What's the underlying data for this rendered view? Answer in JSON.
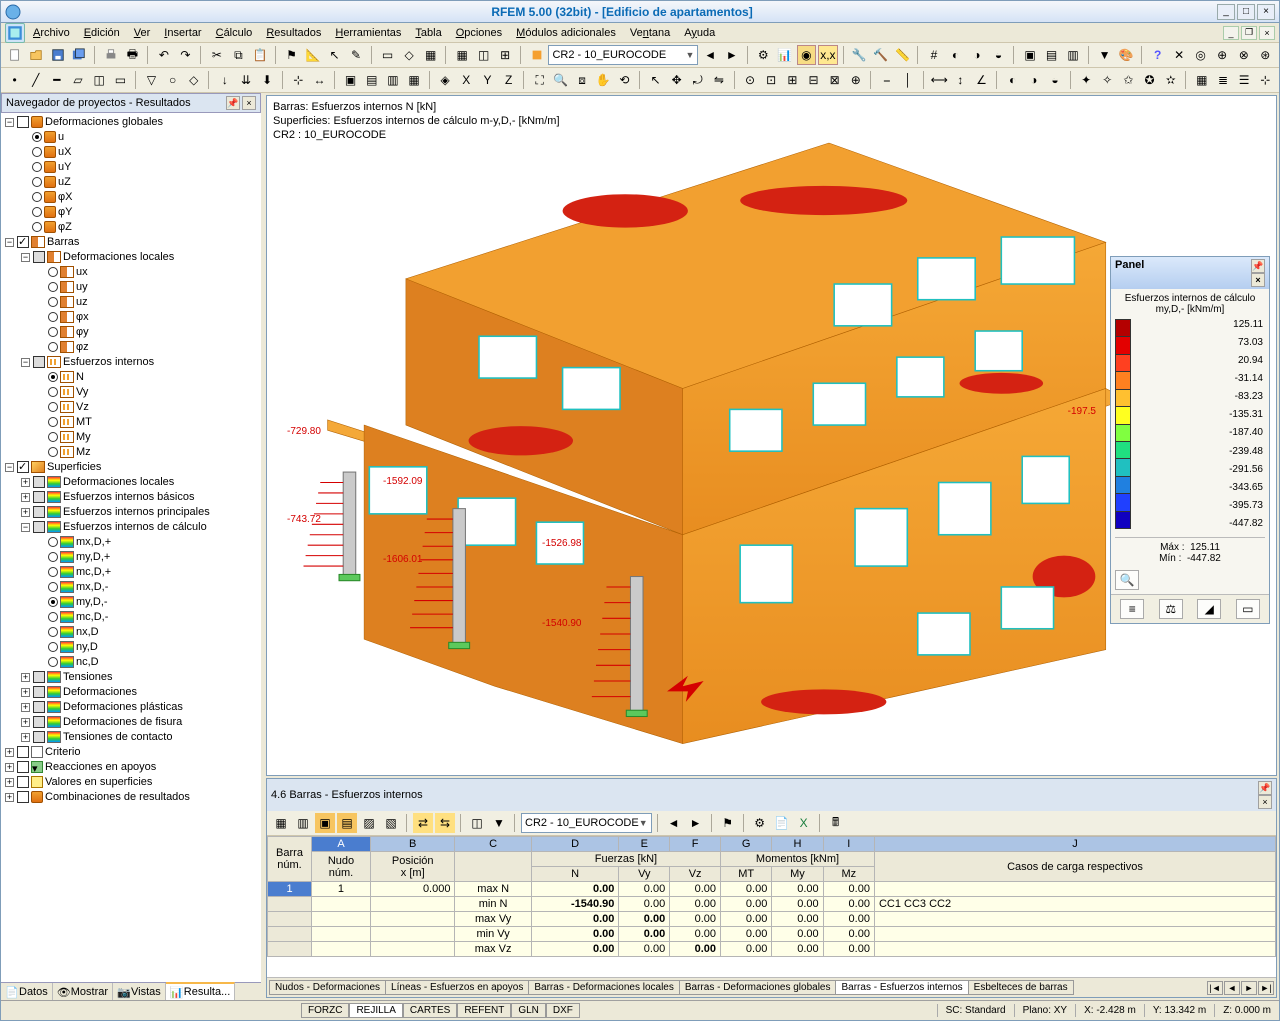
{
  "title": "RFEM 5.00 (32bit) - [Edificio de apartamentos]",
  "menu": [
    "Archivo",
    "Edición",
    "Ver",
    "Insertar",
    "Cálculo",
    "Resultados",
    "Herramientas",
    "Tabla",
    "Opciones",
    "Módulos adicionales",
    "Ventana",
    "Ayuda"
  ],
  "toolbar_combo": "CR2 - 10_EUROCODE",
  "navigator": {
    "title": "Navegador de proyectos - Resultados",
    "items": {
      "def_glob": "Deformaciones globales",
      "u": "u",
      "ux": "uX",
      "uy": "uY",
      "uz": "uZ",
      "phix": "φX",
      "phiy": "φY",
      "phiz": "φZ",
      "barras": "Barras",
      "def_loc": "Deformaciones locales",
      "ux2": "ux",
      "uy2": "uy",
      "uz2": "uz",
      "phix2": "φx",
      "phiy2": "φy",
      "phiz2": "φz",
      "esf_int": "Esfuerzos internos",
      "N": "N",
      "Vy": "Vy",
      "Vz": "Vz",
      "MT": "MT",
      "My": "My",
      "Mz": "Mz",
      "superficies": "Superficies",
      "sup_defloc": "Deformaciones locales",
      "sup_esfb": "Esfuerzos internos básicos",
      "sup_esfp": "Esfuerzos internos principales",
      "sup_esfc": "Esfuerzos internos de cálculo",
      "mxdp": "mx,D,+",
      "mydp": "my,D,+",
      "mcdp": "mc,D,+",
      "mxdm": "mx,D,-",
      "mydm": "my,D,-",
      "mcdm": "mc,D,-",
      "nxd": "nx,D",
      "nyd": "ny,D",
      "ncd": "nc,D",
      "tensiones": "Tensiones",
      "deformaciones": "Deformaciones",
      "def_plast": "Deformaciones plásticas",
      "def_fis": "Deformaciones de fisura",
      "ten_cont": "Tensiones de contacto",
      "criterio": "Criterio",
      "reac": "Reacciones en apoyos",
      "val_sup": "Valores en superficies",
      "comb": "Combinaciones de resultados"
    },
    "tabs": [
      "Datos",
      "Mostrar",
      "Vistas",
      "Resulta..."
    ]
  },
  "canvas": {
    "lines": [
      "Barras: Esfuerzos internos N [kN]",
      "Superficies: Esfuerzos internos de cálculo m-y,D,- [kNm/m]",
      "CR2 : 10_EUROCODE"
    ],
    "annotations": {
      "a1": "-729.80",
      "a2": "-743.72",
      "a3": "-1592.09",
      "a4": "-1606.01",
      "a5": "-1526.98",
      "a6": "-1540.90",
      "a7": "-197.5"
    }
  },
  "panel": {
    "title": "Panel",
    "scale_title": "Esfuerzos internos de cálculo my,D,- [kNm/m]",
    "scale_values": [
      "125.11",
      "73.03",
      "20.94",
      "-31.14",
      "-83.23",
      "-135.31",
      "-187.40",
      "-239.48",
      "-291.56",
      "-343.65",
      "-395.73",
      "-447.82"
    ],
    "scale_colors": [
      "#b40000",
      "#e30000",
      "#ff4020",
      "#ff8020",
      "#ffc030",
      "#ffff20",
      "#80ff40",
      "#20e080",
      "#20c0c0",
      "#2080e0",
      "#2040ff",
      "#1000c0"
    ],
    "max_label": "Máx :",
    "max": "125.11",
    "min_label": "Mín :",
    "min": "-447.82"
  },
  "datapanel": {
    "title": "4.6 Barras - Esfuerzos internos",
    "combo": "CR2 - 10_EUROCODE",
    "col_letters": [
      "A",
      "B",
      "C",
      "D",
      "E",
      "F",
      "G",
      "H",
      "I",
      "J"
    ],
    "group_headers": {
      "fuerzas": "Fuerzas [kN]",
      "momentos": "Momentos [kNm]",
      "casos": "Casos de carga respectivos"
    },
    "headers": {
      "barra": "Barra\nnúm.",
      "nudo": "Nudo\nnúm.",
      "pos": "Posición\nx [m]",
      "N": "N",
      "Vy": "Vy",
      "Vz": "Vz",
      "MT": "MT",
      "My": "My",
      "Mz": "Mz"
    },
    "row_labels": [
      "max N",
      "min N",
      "max Vy",
      "min Vy",
      "max Vz"
    ],
    "rows": [
      {
        "barra": "1",
        "nudo": "1",
        "pos": "0.000",
        "lab": "max N",
        "N": "0.00",
        "Vy": "0.00",
        "Vz": "0.00",
        "MT": "0.00",
        "My": "0.00",
        "Mz": "0.00",
        "cc": ""
      },
      {
        "barra": "",
        "nudo": "",
        "pos": "",
        "lab": "min N",
        "N": "-1540.90",
        "Nhl": true,
        "Vy": "0.00",
        "Vz": "0.00",
        "MT": "0.00",
        "My": "0.00",
        "Mz": "0.00",
        "cc": "CC1 CC3 CC2"
      },
      {
        "barra": "",
        "nudo": "",
        "pos": "",
        "lab": "max Vy",
        "N": "0.00",
        "Vy": "0.00",
        "Vz": "0.00",
        "MT": "0.00",
        "My": "0.00",
        "Mz": "0.00",
        "cc": ""
      },
      {
        "barra": "",
        "nudo": "",
        "pos": "",
        "lab": "min Vy",
        "N": "0.00",
        "Vy": "0.00",
        "Vz": "0.00",
        "MT": "0.00",
        "My": "0.00",
        "Mz": "0.00",
        "cc": ""
      },
      {
        "barra": "",
        "nudo": "",
        "pos": "",
        "lab": "max Vz",
        "N": "0.00",
        "Vy": "0.00",
        "Vz": "0.00",
        "MT": "0.00",
        "My": "0.00",
        "Mz": "0.00",
        "cc": ""
      }
    ],
    "tabs": [
      "Nudos - Deformaciones",
      "Líneas - Esfuerzos en apoyos",
      "Barras - Deformaciones locales",
      "Barras - Deformaciones globales",
      "Barras - Esfuerzos internos",
      "Esbelteces de barras"
    ]
  },
  "status": {
    "segments": [
      "FORZC",
      "REJILLA",
      "CARTES",
      "REFENT",
      "GLN",
      "DXF"
    ],
    "active_seg": 1,
    "sc": "SC: Standard",
    "plano": "Plano: XY",
    "x": "X: -2.428 m",
    "y": "Y: 13.342 m",
    "z": "Z: 0.000 m"
  }
}
